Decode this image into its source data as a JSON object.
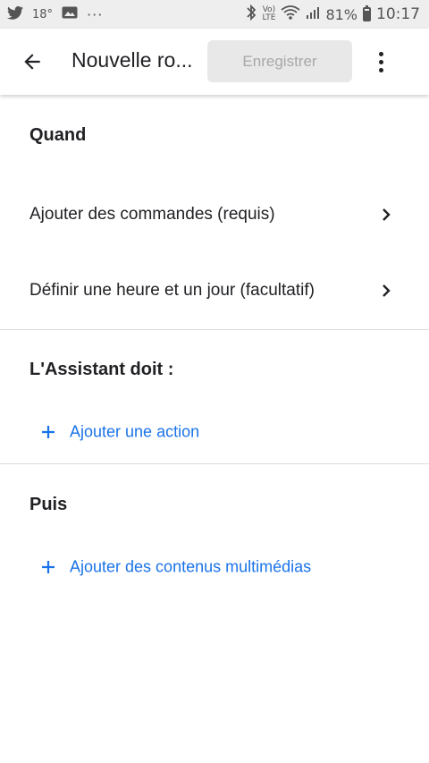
{
  "status_bar": {
    "temperature": "18°",
    "dots": "···",
    "network_top": "Vo)",
    "network_bottom": "LTE",
    "battery_percent": "81%",
    "time": "10:17"
  },
  "app_bar": {
    "title": "Nouvelle ro...",
    "save_label": "Enregistrer"
  },
  "sections": {
    "when": {
      "title": "Quand",
      "items": [
        {
          "label": "Ajouter des commandes (requis)"
        },
        {
          "label": "Définir une heure et un jour (facultatif)"
        }
      ]
    },
    "assistant": {
      "title": "L'Assistant doit :",
      "add_label": "Ajouter une action"
    },
    "then": {
      "title": "Puis",
      "add_label": "Ajouter des contenus multimédias"
    }
  },
  "colors": {
    "accent": "#1a73e8",
    "status_bar": "#eeeeee",
    "disabled_button": "#e8e8e8"
  }
}
